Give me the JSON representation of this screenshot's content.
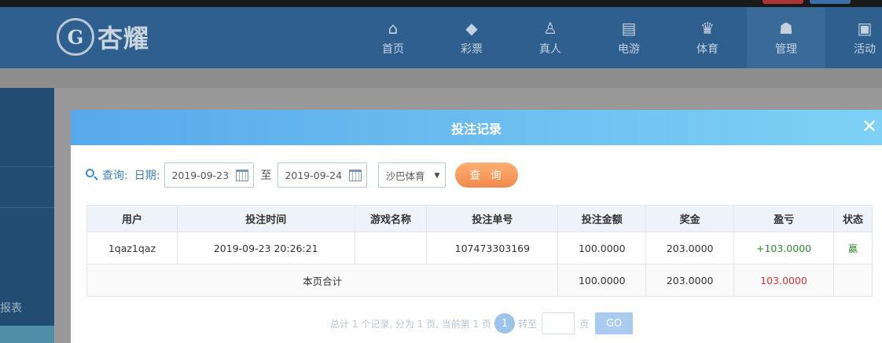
{
  "header": {
    "logo_emblem": "G",
    "logo_text": "杏耀",
    "nav": [
      {
        "label": "首页",
        "icon": "home-icon"
      },
      {
        "label": "彩票",
        "icon": "ticket-icon"
      },
      {
        "label": "真人",
        "icon": "dealer-icon"
      },
      {
        "label": "电游",
        "icon": "slot-machine-icon"
      },
      {
        "label": "体育",
        "icon": "trophy-icon"
      },
      {
        "label": "管理",
        "icon": "users-icon"
      },
      {
        "label": "活动",
        "icon": "gift-icon"
      }
    ]
  },
  "background": {
    "page_title": "",
    "sidebar_report_label": "报表"
  },
  "modal": {
    "title": "投注记录",
    "close_glyph": "✕",
    "query_label": "查询:",
    "date_label": "日期:",
    "start_date": "2019-09-23",
    "to_label": "至",
    "end_date": "2019-09-24",
    "game_select": "沙巴体育",
    "query_button": "查 询",
    "columns": [
      "用户",
      "投注时间",
      "游戏名称",
      "投注单号",
      "投注金额",
      "奖金",
      "盈亏",
      "状态"
    ],
    "rows": [
      {
        "user": "1qaz1qaz",
        "time": "2019-09-23 20:26:21",
        "game": "",
        "order_no": "107473303169",
        "amount": "100.0000",
        "bonus": "203.0000",
        "profit": "+103.0000",
        "status": "赢"
      }
    ],
    "total": {
      "label": "本页合计",
      "amount": "100.0000",
      "bonus": "203.0000",
      "profit": "103.0000"
    },
    "pager": {
      "summary": "总计 1 个记录, 分为 1 页, 当前第 1 页",
      "current_page": "1",
      "goto_label": "转至",
      "page_unit": "页",
      "go_button": "GO"
    }
  },
  "colors": {
    "header_bg": "#2e5f8f",
    "modal_header_gradient": [
      "#58a9eb",
      "#7ed1f5"
    ],
    "query_button_gradient": [
      "#fdb173",
      "#f2884b"
    ],
    "profit_positive": "#2f8a2f",
    "profit_total": "#d33"
  }
}
